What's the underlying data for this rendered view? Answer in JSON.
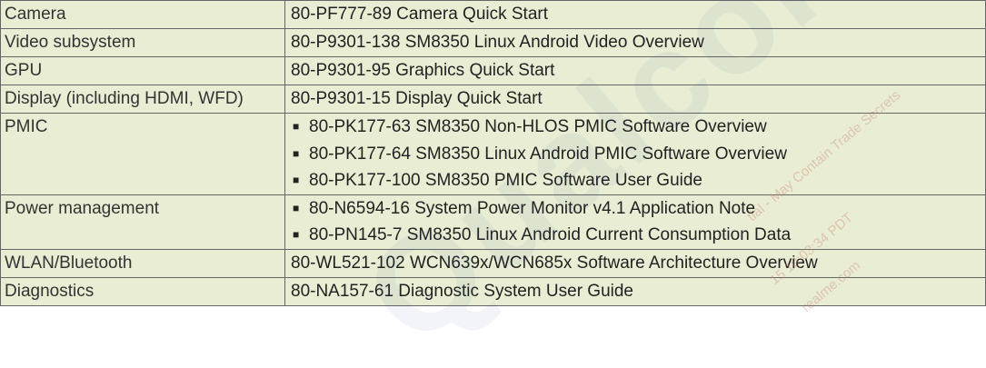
{
  "table": {
    "rows": [
      {
        "topic": "Camera",
        "docs": [
          "80-PF777-89 Camera Quick Start"
        ],
        "bulleted": false
      },
      {
        "topic": "Video subsystem",
        "docs": [
          "80-P9301-138 SM8350 Linux Android Video Overview"
        ],
        "bulleted": false
      },
      {
        "topic": "GPU",
        "docs": [
          "80-P9301-95 Graphics Quick Start"
        ],
        "bulleted": false
      },
      {
        "topic": "Display (including HDMI, WFD)",
        "docs": [
          "80-P9301-15 Display Quick Start"
        ],
        "bulleted": false
      },
      {
        "topic": "PMIC",
        "docs": [
          "80-PK177-63 SM8350 Non-HLOS PMIC Software Overview",
          "80-PK177-64 SM8350 Linux Android PMIC Software Overview",
          "80-PK177-100 SM8350 PMIC Software User Guide"
        ],
        "bulleted": true
      },
      {
        "topic": "Power management",
        "docs": [
          "80-N6594-16 System Power Monitor v4.1 Application Note",
          "80-PN145-7 SM8350 Linux Android Current Consumption Data"
        ],
        "bulleted": true
      },
      {
        "topic": "WLAN/Bluetooth",
        "docs": [
          "80-WL521-102 WCN639x/WCN685x Software Architecture Overview"
        ],
        "bulleted": false
      },
      {
        "topic": "Diagnostics",
        "docs": [
          "80-NA157-61 Diagnostic System User Guide"
        ],
        "bulleted": false
      }
    ],
    "bullet_glyph": "■"
  },
  "watermark": {
    "brand": "Qualcomm",
    "lines": [
      "tial - May Contain Trade Secrets",
      "15 10:03:34 PDT",
      "realme.com"
    ]
  },
  "colors": {
    "cell_background": "#e8edd3",
    "border": "#666666",
    "text": "#222222"
  }
}
